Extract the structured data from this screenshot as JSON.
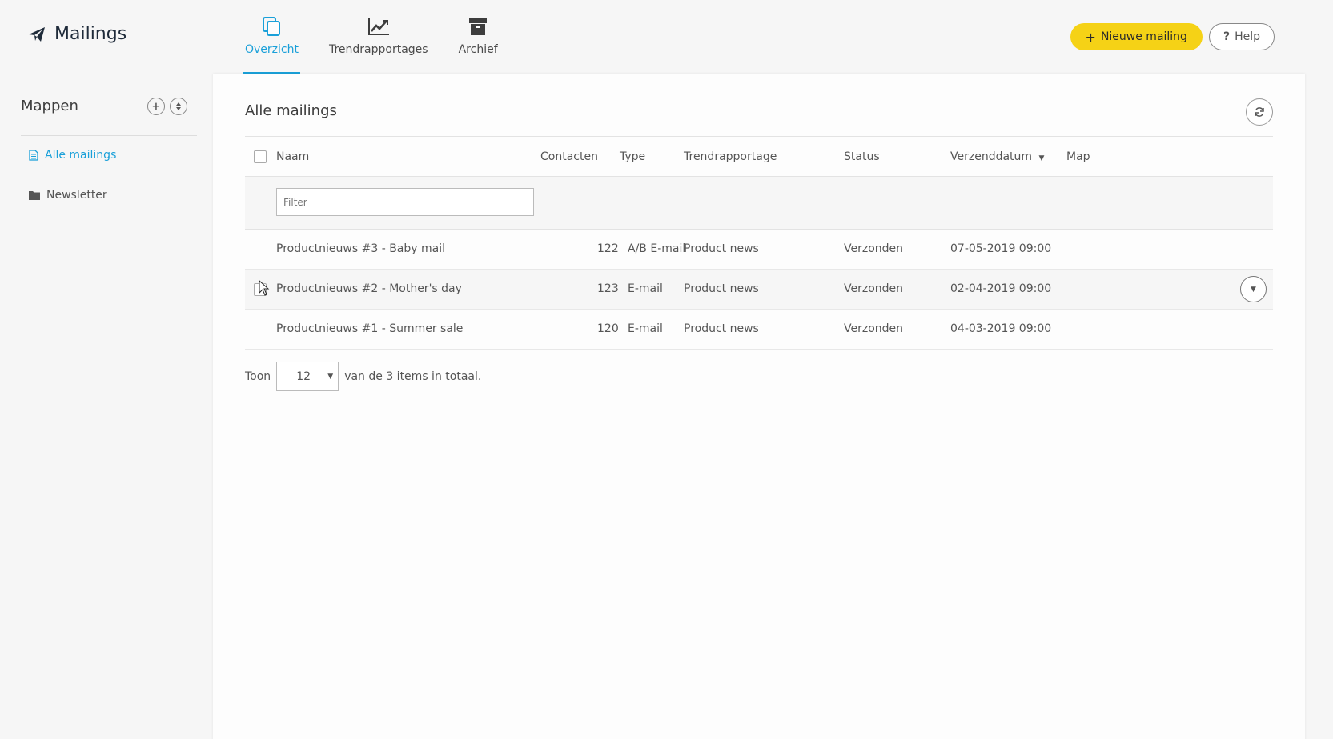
{
  "app": {
    "title": "Mailings",
    "icon": "paper-plane-icon"
  },
  "nav": {
    "tabs": [
      {
        "label": "Overzicht",
        "icon": "copy-icon",
        "active": true
      },
      {
        "label": "Trendrapportages",
        "icon": "line-chart-icon",
        "active": false
      },
      {
        "label": "Archief",
        "icon": "archive-icon",
        "active": false
      }
    ]
  },
  "actions": {
    "new_mailing": "Nieuwe mailing",
    "help": "Help"
  },
  "sidebar": {
    "title": "Mappen",
    "items": [
      {
        "label": "Alle mailings",
        "icon": "document-icon",
        "active": true
      },
      {
        "label": "Newsletter",
        "icon": "folder-icon",
        "active": false
      }
    ]
  },
  "main": {
    "title": "Alle mailings",
    "columns": {
      "naam": "Naam",
      "contacten": "Contacten",
      "type": "Type",
      "trend": "Trendrapportage",
      "status": "Status",
      "datum": "Verzenddatum",
      "map": "Map"
    },
    "filter_placeholder": "Filter",
    "rows": [
      {
        "naam": "Productnieuws #3 - Baby mail",
        "contacten": "122",
        "type": "A/B E-mail",
        "trend": "Product news",
        "status": "Verzonden",
        "datum": "07-05-2019 09:00",
        "map": ""
      },
      {
        "naam": "Productnieuws #2 - Mother's day",
        "contacten": "123",
        "type": "E-mail",
        "trend": "Product news",
        "status": "Verzonden",
        "datum": "02-04-2019 09:00",
        "map": ""
      },
      {
        "naam": "Productnieuws #1 - Summer sale",
        "contacten": "120",
        "type": "E-mail",
        "trend": "Product news",
        "status": "Verzonden",
        "datum": "04-03-2019 09:00",
        "map": ""
      }
    ],
    "pager": {
      "prefix": "Toon",
      "page_size": "12",
      "suffix": "van de 3 items in totaal."
    }
  },
  "colors": {
    "accent": "#1aa0d9",
    "primary_button": "#f5d216",
    "brand_text": "#1f2b3a"
  }
}
